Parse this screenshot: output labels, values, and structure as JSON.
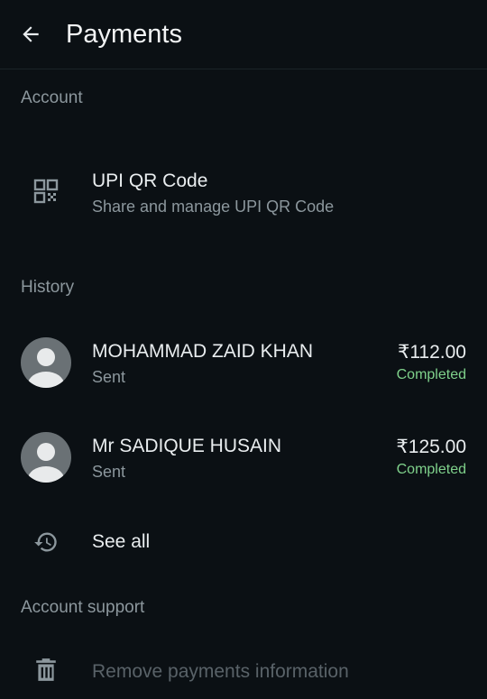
{
  "header": {
    "title": "Payments",
    "back_icon": "arrow-left-icon"
  },
  "account": {
    "section_label": "Account",
    "qr": {
      "icon": "qr-code-icon",
      "title": "UPI QR Code",
      "subtitle": "Share and manage UPI QR Code"
    }
  },
  "history": {
    "section_label": "History",
    "items": [
      {
        "name": "MOHAMMAD ZAID KHAN",
        "direction": "Sent",
        "amount": "₹112.00",
        "status": "Completed"
      },
      {
        "name": "Mr SADIQUE HUSAIN",
        "direction": "Sent",
        "amount": "₹125.00",
        "status": "Completed"
      }
    ],
    "see_all": {
      "icon": "history-icon",
      "label": "See all"
    }
  },
  "support": {
    "section_label": "Account support",
    "remove": {
      "icon": "trash-icon",
      "label": "Remove payments information"
    }
  },
  "colors": {
    "background": "#0b1014",
    "status_completed": "#7fd18b",
    "muted": "#8c979d"
  }
}
